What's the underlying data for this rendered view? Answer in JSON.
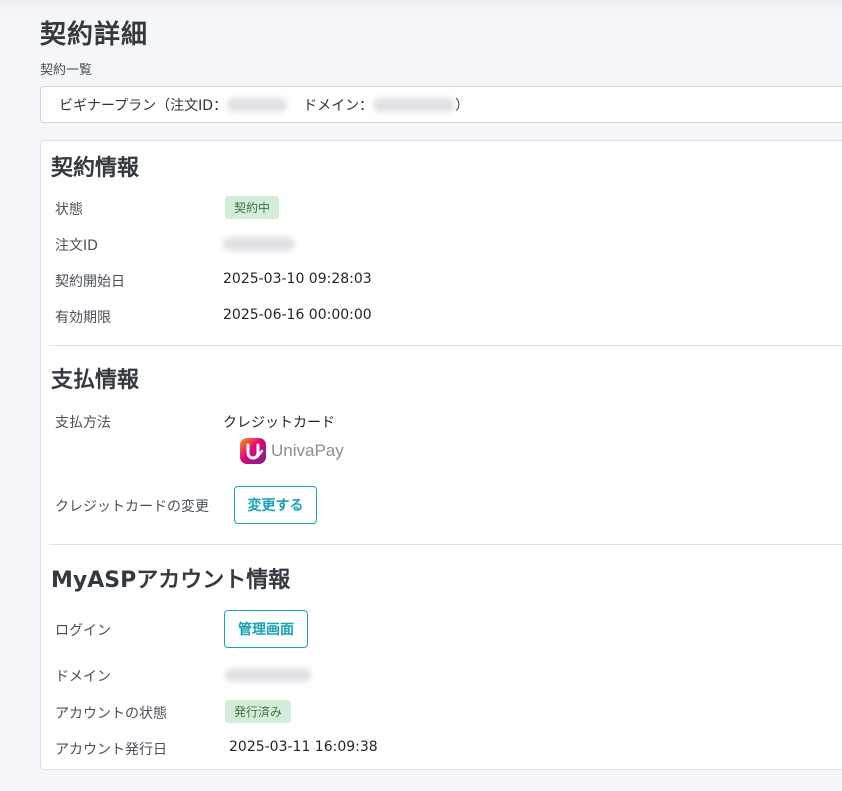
{
  "page": {
    "title": "契約詳細",
    "breadcrumb": "契約一覧"
  },
  "contract_select": {
    "value_prefix": "ビギナープラン（注文ID：",
    "value_middle": "ドメイン：",
    "value_suffix": "）"
  },
  "contract_info": {
    "title": "契約情報",
    "status_label": "状態",
    "status_value": "契約中",
    "order_id_label": "注文ID",
    "start_date_label": "契約開始日",
    "start_date_value": "2025-03-10 09:28:03",
    "expiry_label": "有効期限",
    "expiry_value": "2025-06-16 00:00:00"
  },
  "payment_info": {
    "title": "支払情報",
    "method_label": "支払方法",
    "method_value": "クレジットカード",
    "provider_logo_text": "UnivaPay",
    "change_card_label": "クレジットカードの変更",
    "change_button": "変更する"
  },
  "account_info": {
    "title": "MyASPアカウント情報",
    "login_label": "ログイン",
    "admin_button": "管理画面",
    "domain_label": "ドメイン",
    "account_status_label": "アカウントの状態",
    "account_status_value": "発行済み",
    "issue_date_label": "アカウント発行日",
    "issue_date_value": "2025-03-11 16:09:38"
  },
  "colors": {
    "accent": "#17a2b8",
    "badge_bg": "#d4edda",
    "badge_text": "#3c763d"
  }
}
